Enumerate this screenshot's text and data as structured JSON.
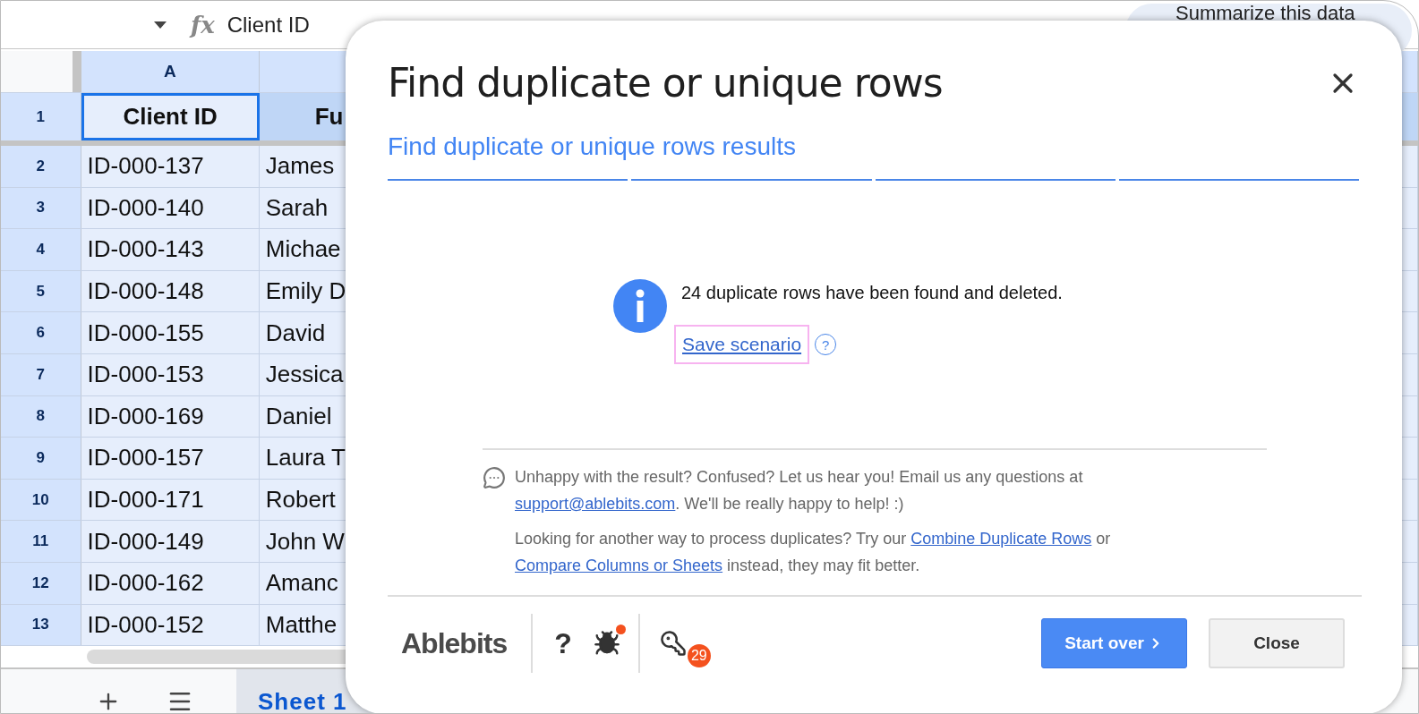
{
  "formula_bar": {
    "function_symbol": "fx",
    "value": "Client ID"
  },
  "ai_chip": {
    "label": "Summarize this data"
  },
  "sheet": {
    "columns": [
      {
        "label": "A",
        "selected": true
      },
      {
        "selected": true
      }
    ],
    "rows": [
      {
        "number": "1",
        "selected": true,
        "kind": "header",
        "cells": [
          "Client ID",
          "Fu"
        ]
      },
      {
        "number": "2",
        "selected": true,
        "kind": "data",
        "cells": [
          "ID-000-137",
          "James"
        ]
      },
      {
        "number": "3",
        "selected": true,
        "kind": "data",
        "cells": [
          "ID-000-140",
          "Sarah"
        ]
      },
      {
        "number": "4",
        "selected": true,
        "kind": "data",
        "cells": [
          "ID-000-143",
          "Michae"
        ]
      },
      {
        "number": "5",
        "selected": true,
        "kind": "data",
        "cells": [
          "ID-000-148",
          "Emily D"
        ]
      },
      {
        "number": "6",
        "selected": true,
        "kind": "data",
        "cells": [
          "ID-000-155",
          "David"
        ]
      },
      {
        "number": "7",
        "selected": true,
        "kind": "data",
        "cells": [
          "ID-000-153",
          "Jessica"
        ]
      },
      {
        "number": "8",
        "selected": true,
        "kind": "data",
        "cells": [
          "ID-000-169",
          "Daniel"
        ]
      },
      {
        "number": "9",
        "selected": true,
        "kind": "data",
        "cells": [
          "ID-000-157",
          "Laura T"
        ]
      },
      {
        "number": "10",
        "selected": true,
        "kind": "data",
        "cells": [
          "ID-000-171",
          "Robert"
        ]
      },
      {
        "number": "11",
        "selected": true,
        "kind": "data",
        "cells": [
          "ID-000-149",
          "John W"
        ]
      },
      {
        "number": "12",
        "selected": true,
        "kind": "data",
        "cells": [
          "ID-000-162",
          "Amanc"
        ]
      },
      {
        "number": "13",
        "selected": true,
        "kind": "data",
        "cells": [
          "ID-000-152",
          "Matthe"
        ]
      }
    ],
    "sheet_tabs": [
      {
        "label": "Sheet 1",
        "selected": true
      }
    ]
  },
  "dialog": {
    "title": "Find duplicate or unique rows",
    "subtitle": "Find duplicate or unique rows results",
    "steps": [
      {
        "completed": true
      },
      {
        "completed": true
      },
      {
        "completed": true
      },
      {
        "completed": true
      }
    ],
    "message": "24 duplicate rows have been found and deleted.",
    "save_link": {
      "label": "Save scenario",
      "focused": true
    },
    "save_help": "?",
    "feedback": [
      [
        {
          "kind": "text",
          "text": "Unhappy with the result? Confused? Let us hear you! Email us any questions at "
        },
        {
          "kind": "link",
          "text": "support@ablebits.com"
        },
        {
          "kind": "text",
          "text": ". We'll be really happy to help! :)"
        }
      ],
      [
        {
          "kind": "text",
          "text": "Looking for another way to process duplicates? Try our "
        },
        {
          "kind": "link",
          "text": "Combine Duplicate Rows"
        },
        {
          "kind": "text",
          "text": " or "
        },
        {
          "kind": "link",
          "text": "Compare Columns or Sheets"
        },
        {
          "kind": "text",
          "text": " instead, they may fit better."
        }
      ]
    ],
    "footer": {
      "logo": "Ablebits",
      "help": "?",
      "bug_notification": true,
      "key_badge": "29",
      "buttons": [
        {
          "label": "Start over",
          "kind": "primary"
        },
        {
          "label": "Close",
          "kind": "secondary"
        }
      ]
    }
  }
}
